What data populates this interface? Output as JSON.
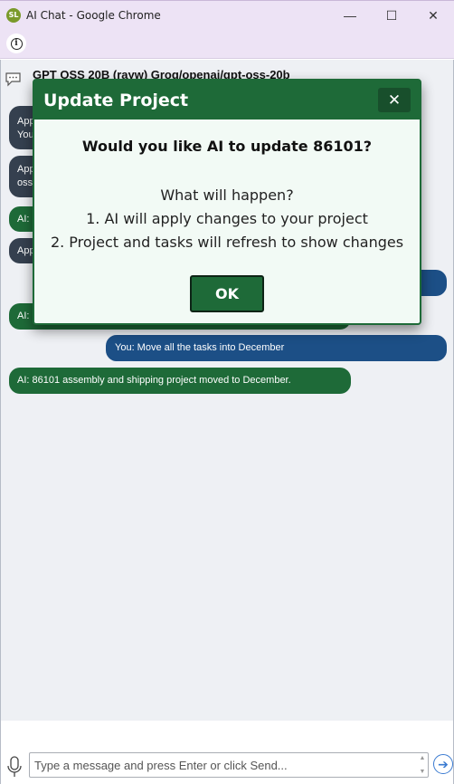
{
  "window": {
    "app_icon": "SL",
    "title": "AI Chat - Google Chrome",
    "controls": {
      "minimize": "—",
      "maximize": "☐",
      "close": "✕"
    }
  },
  "addressbar": {
    "info_icon": "i"
  },
  "chat": {
    "model": "GPT OSS 20B (rayw)  Groq/openai/gpt-oss-20b",
    "messages": [
      {
        "role": "sys",
        "text": "App"
      },
      {
        "role": "sys",
        "text": "You"
      },
      {
        "role": "sys",
        "text": "App"
      },
      {
        "role": "sys",
        "text": "oss"
      },
      {
        "role": "ai",
        "text": "AI:"
      },
      {
        "role": "sys",
        "text": "App"
      },
      {
        "role": "user",
        "text": ""
      },
      {
        "role": "ai",
        "text": "AI:"
      },
      {
        "role": "user",
        "text": "You: Move all the tasks into December"
      },
      {
        "role": "ai",
        "text": "AI: 86101 assembly and shipping project moved to December."
      }
    ]
  },
  "dialog": {
    "title": "Update Project",
    "close_label": "✕",
    "question": "Would you like AI to update 86101?",
    "what_heading": "What will happen?",
    "step1": "1. AI will apply changes to your project",
    "step2": "2. Project and tasks will refresh to show changes",
    "ok_label": "OK"
  },
  "composer": {
    "placeholder": "Type a message and press Enter or click Send...",
    "value": "",
    "spin_up": "▲",
    "spin_down": "▼",
    "send_icon": "➔"
  },
  "colors": {
    "ai_bubble": "#1e6a38",
    "user_bubble": "#1c4f86",
    "system_bubble": "#35404f",
    "dialog_header": "#1e6a38",
    "chrome_bar": "#ede3f5"
  }
}
